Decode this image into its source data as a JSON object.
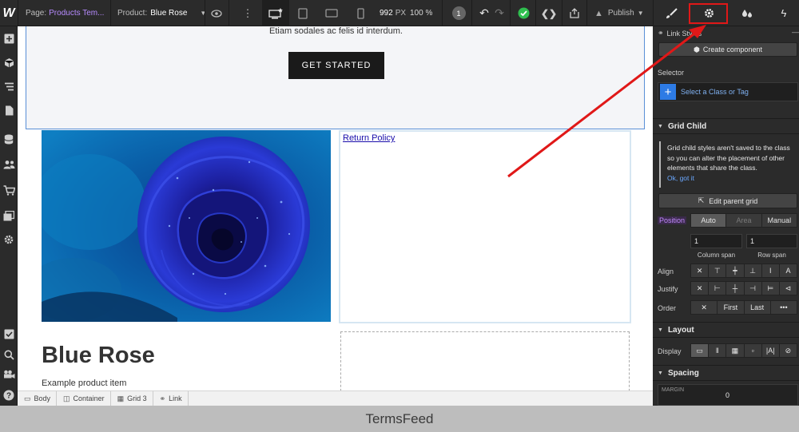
{
  "topbar": {
    "page_label": "Page:",
    "page_name": "Products Tem...",
    "product_label": "Product:",
    "product_name": "Blue Rose",
    "width": "992",
    "px": "PX",
    "zoom": "100 %",
    "badge_count": "1",
    "publish": "Publish"
  },
  "canvas": {
    "hero_text": "Etiam sodales ac felis id interdum.",
    "cta_label": "GET STARTED",
    "policy_link": "Return Policy",
    "product_title": "Blue Rose",
    "product_subtitle": "Example product item"
  },
  "breadcrumb": [
    {
      "label": "Body"
    },
    {
      "label": "Container"
    },
    {
      "label": "Grid 3"
    },
    {
      "label": "Link"
    }
  ],
  "panel": {
    "link_styles": "Link Styles",
    "create_component": "Create component",
    "selector_label": "Selector",
    "selector_placeholder": "Select a Class or Tag",
    "grid_child_title": "Grid Child",
    "notice_text": "Grid child styles aren't saved to the class so you can alter the placement of other elements that share the class.",
    "notice_ok": "Ok, got it",
    "edit_parent_grid": "Edit parent grid",
    "position_label": "Position",
    "position_options": [
      "Auto",
      "Area",
      "Manual"
    ],
    "column_span_value": "1",
    "row_span_value": "1",
    "column_span_caption": "Column span",
    "row_span_caption": "Row span",
    "align_label": "Align",
    "justify_label": "Justify",
    "order_label": "Order",
    "order_options": [
      "First",
      "Last"
    ],
    "layout_title": "Layout",
    "display_label": "Display",
    "spacing_title": "Spacing",
    "margin_label": "MARGIN",
    "margin_value": "0"
  },
  "footer": {
    "watermark": "TermsFeed"
  },
  "colors": {
    "selection_highlight": "#e01818",
    "arrow": "#e01818",
    "accent_blue": "#2d7be5",
    "position_purple": "#c38aff"
  }
}
